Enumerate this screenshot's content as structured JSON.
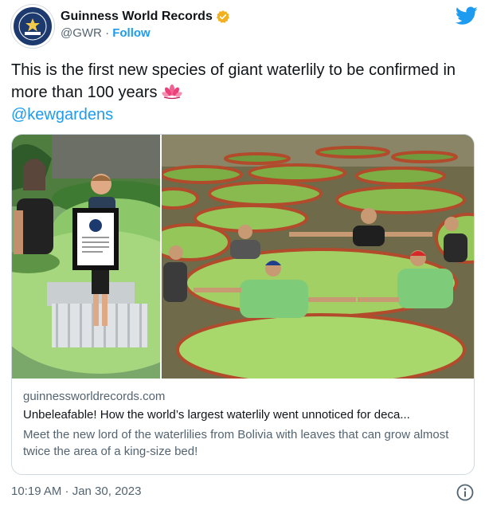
{
  "author": {
    "name": "Guinness World Records",
    "handle": "@GWR",
    "separator": "·",
    "follow_label": "Follow",
    "avatar_icon": "guinness-logo-icon",
    "verified_icon": "verified-badge-icon"
  },
  "tweet": {
    "text": "This is the first new species of giant waterlily to be confirmed in more than 100 years",
    "emoji_icon": "lotus-icon",
    "mention": "@kewgardens"
  },
  "card": {
    "domain": "guinnessworldrecords.com",
    "title": "Unbeleafable! How the world’s largest waterlily went unnoticed for deca...",
    "description": "Meet the new lord of the waterlilies from Bolivia with leaves that can grow almost twice the area of a king-size bed!"
  },
  "footer": {
    "timestamp": "10:19 AM · Jan 30, 2023",
    "info_icon": "info-icon"
  },
  "colors": {
    "link": "#1d9bf0",
    "secondary_text": "#536471",
    "verified": "#f2b01e",
    "twitter_blue": "#1d9bf0"
  }
}
